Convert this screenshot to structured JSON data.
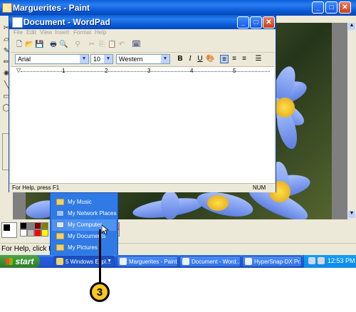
{
  "paint": {
    "title": "Marguerites - Paint",
    "status_text": "For Help, click Help Topics"
  },
  "wordpad": {
    "title": "Document - WordPad",
    "menu": [
      "File",
      "Edit",
      "View",
      "Insert",
      "Format",
      "Help"
    ],
    "font_name": "Arial",
    "font_size": "10",
    "script": "Western",
    "bold_label": "B",
    "italic_label": "I",
    "underline_label": "U",
    "ruler_numbers": [
      "1",
      "2",
      "3",
      "4",
      "5"
    ],
    "status_text": "For Help, press F1",
    "status_num": "NUM"
  },
  "popup": {
    "items": [
      {
        "label": "My Music",
        "icon": "folder-music-icon"
      },
      {
        "label": "My Network Places",
        "icon": "network-places-icon"
      },
      {
        "label": "My Computer",
        "icon": "my-computer-icon"
      },
      {
        "label": "My Documents",
        "icon": "folder-documents-icon"
      },
      {
        "label": "My Pictures",
        "icon": "folder-pictures-icon"
      }
    ],
    "highlighted_index": 2
  },
  "taskbar": {
    "start_label": "start",
    "tasks": [
      {
        "label": "5 Windows Expl..."
      },
      {
        "label": "Marguerites - Paint"
      },
      {
        "label": "Document - Word..."
      },
      {
        "label": "HyperSnap-DX Pr..."
      }
    ],
    "clock": "12:53 PM"
  },
  "callout": {
    "number": "3"
  },
  "colors": {
    "xp_blue": "#245edc",
    "start_green": "#3a9134",
    "callout_yellow": "#f7c71e"
  }
}
